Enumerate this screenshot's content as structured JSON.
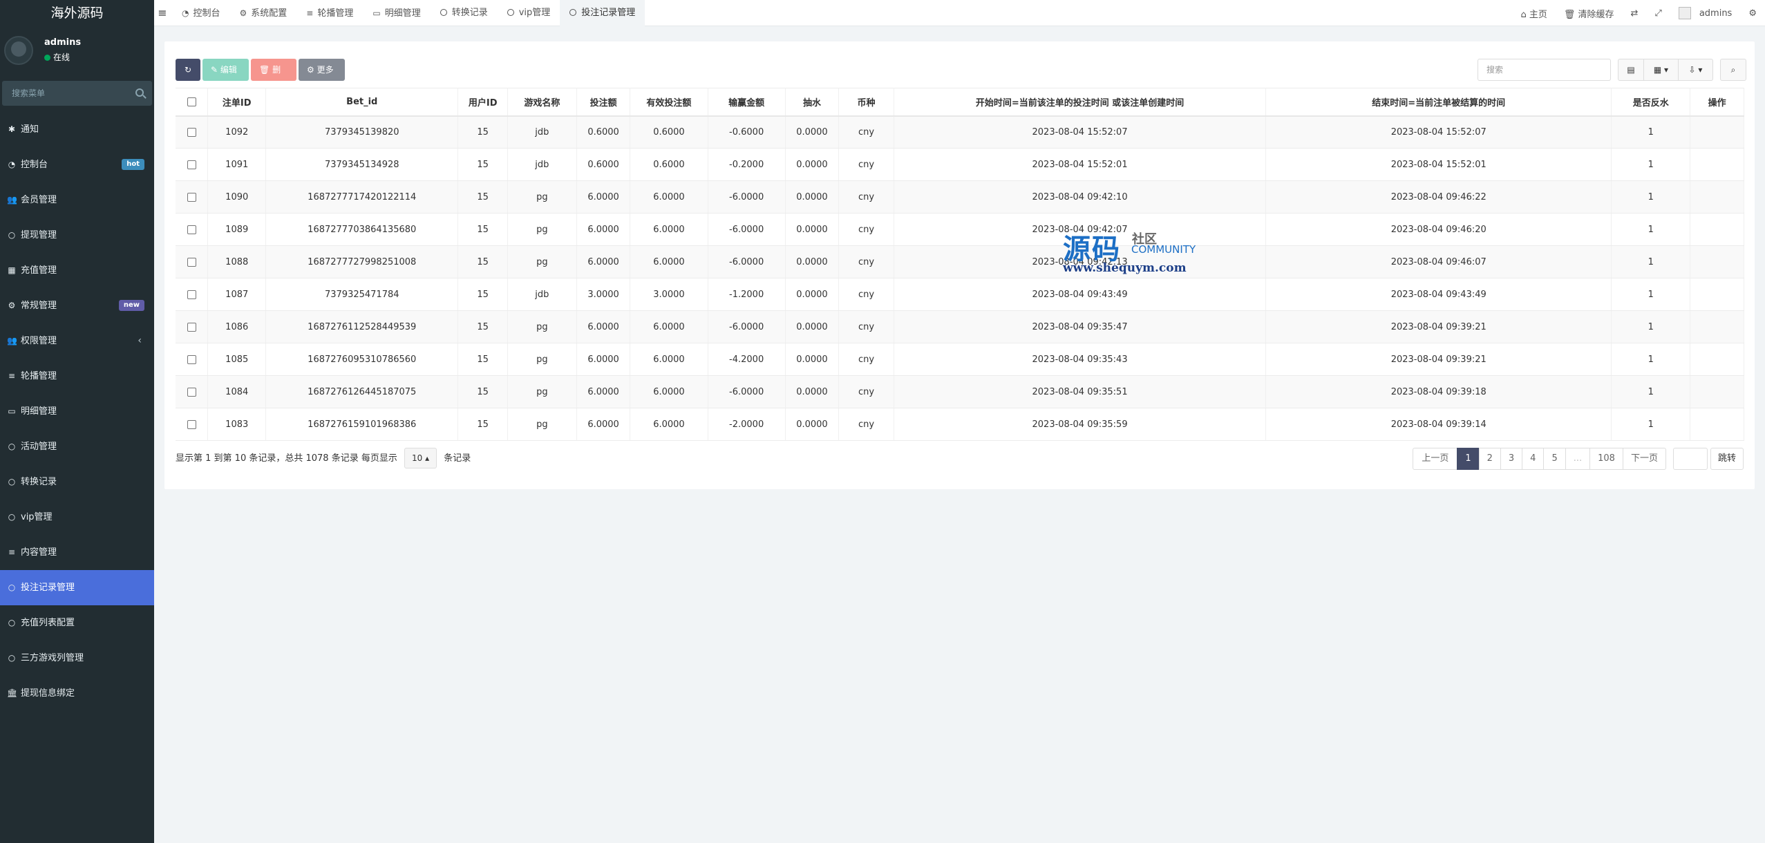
{
  "sidebar": {
    "brand": "海外源码",
    "user": {
      "name": "admins",
      "status": "在线"
    },
    "search_placeholder": "搜索菜单",
    "items": [
      {
        "label": "通知",
        "icon": "✱"
      },
      {
        "label": "控制台",
        "icon": "◔",
        "badge": "hot"
      },
      {
        "label": "会员管理",
        "icon": "👥"
      },
      {
        "label": "提现管理",
        "icon": "○"
      },
      {
        "label": "充值管理",
        "icon": "▦"
      },
      {
        "label": "常规管理",
        "icon": "⚙",
        "badge": "new"
      },
      {
        "label": "权限管理",
        "icon": "👥",
        "chevron": "‹"
      },
      {
        "label": "轮播管理",
        "icon": "≡"
      },
      {
        "label": "明细管理",
        "icon": "▭"
      },
      {
        "label": "活动管理",
        "icon": "○"
      },
      {
        "label": "转换记录",
        "icon": "○"
      },
      {
        "label": "vip管理",
        "icon": "○"
      },
      {
        "label": "内容管理",
        "icon": "≡"
      },
      {
        "label": "投注记录管理",
        "icon": "○",
        "active": true
      },
      {
        "label": "充值列表配置",
        "icon": "○"
      },
      {
        "label": "三方游戏列管理",
        "icon": "○"
      },
      {
        "label": "提现信息绑定",
        "icon": "🏛"
      }
    ]
  },
  "topbar": {
    "tabs": [
      {
        "label": "控制台",
        "icon": "◔"
      },
      {
        "label": "系统配置",
        "icon": "⚙"
      },
      {
        "label": "轮播管理",
        "icon": "≡"
      },
      {
        "label": "明细管理",
        "icon": "▭"
      },
      {
        "label": "转换记录",
        "icon": "ring"
      },
      {
        "label": "vip管理",
        "icon": "ring"
      },
      {
        "label": "投注记录管理",
        "icon": "ring",
        "active": true
      }
    ],
    "home": "主页",
    "clear_cache": "清除缓存",
    "username": "admins"
  },
  "toolbar": {
    "edit": "编辑",
    "delete": "删除",
    "more": "更多",
    "search_placeholder": "搜索"
  },
  "table": {
    "columns": [
      "注单ID",
      "Bet_id",
      "用户ID",
      "游戏名称",
      "投注额",
      "有效投注额",
      "输赢金额",
      "抽水",
      "币种",
      "开始时间=当前该注单的投注时间 或该注单创建时间",
      "结束时间=当前注单被结算的时间",
      "是否反水",
      "操作"
    ],
    "rows": [
      [
        "1092",
        "7379345139820",
        "15",
        "jdb",
        "0.6000",
        "0.6000",
        "-0.6000",
        "0.0000",
        "cny",
        "2023-08-04 15:52:07",
        "2023-08-04 15:52:07",
        "1",
        ""
      ],
      [
        "1091",
        "7379345134928",
        "15",
        "jdb",
        "0.6000",
        "0.6000",
        "-0.2000",
        "0.0000",
        "cny",
        "2023-08-04 15:52:01",
        "2023-08-04 15:52:01",
        "1",
        ""
      ],
      [
        "1090",
        "1687277717420122114",
        "15",
        "pg",
        "6.0000",
        "6.0000",
        "-6.0000",
        "0.0000",
        "cny",
        "2023-08-04 09:42:10",
        "2023-08-04 09:46:22",
        "1",
        ""
      ],
      [
        "1089",
        "1687277703864135680",
        "15",
        "pg",
        "6.0000",
        "6.0000",
        "-6.0000",
        "0.0000",
        "cny",
        "2023-08-04 09:42:07",
        "2023-08-04 09:46:20",
        "1",
        ""
      ],
      [
        "1088",
        "1687277727998251008",
        "15",
        "pg",
        "6.0000",
        "6.0000",
        "-6.0000",
        "0.0000",
        "cny",
        "2023-08-04 09:42:13",
        "2023-08-04 09:46:07",
        "1",
        ""
      ],
      [
        "1087",
        "7379325471784",
        "15",
        "jdb",
        "3.0000",
        "3.0000",
        "-1.2000",
        "0.0000",
        "cny",
        "2023-08-04 09:43:49",
        "2023-08-04 09:43:49",
        "1",
        ""
      ],
      [
        "1086",
        "1687276112528449539",
        "15",
        "pg",
        "6.0000",
        "6.0000",
        "-6.0000",
        "0.0000",
        "cny",
        "2023-08-04 09:35:47",
        "2023-08-04 09:39:21",
        "1",
        ""
      ],
      [
        "1085",
        "1687276095310786560",
        "15",
        "pg",
        "6.0000",
        "6.0000",
        "-4.2000",
        "0.0000",
        "cny",
        "2023-08-04 09:35:43",
        "2023-08-04 09:39:21",
        "1",
        ""
      ],
      [
        "1084",
        "1687276126445187075",
        "15",
        "pg",
        "6.0000",
        "6.0000",
        "-6.0000",
        "0.0000",
        "cny",
        "2023-08-04 09:35:51",
        "2023-08-04 09:39:18",
        "1",
        ""
      ],
      [
        "1083",
        "1687276159101968386",
        "15",
        "pg",
        "6.0000",
        "6.0000",
        "-2.0000",
        "0.0000",
        "cny",
        "2023-08-04 09:35:59",
        "2023-08-04 09:39:14",
        "1",
        ""
      ]
    ]
  },
  "footer": {
    "summary": "显示第 1 到第 10 条记录，总共 1078 条记录 每页显示",
    "page_size": "10",
    "suffix": "条记录"
  },
  "pager": {
    "prev": "上一页",
    "pages": [
      "1",
      "2",
      "3",
      "4",
      "5",
      "...",
      "108"
    ],
    "current": "1",
    "next": "下一页",
    "jump": "跳转"
  },
  "watermark": {
    "main": "源码",
    "sub1": "社区",
    "sub2": "COMMUNITY",
    "url": "www.shequym.com"
  },
  "colors": {
    "sidebar_bg": "#222d32",
    "active_menu": "#4a6edb",
    "primary_btn": "#444c69"
  }
}
